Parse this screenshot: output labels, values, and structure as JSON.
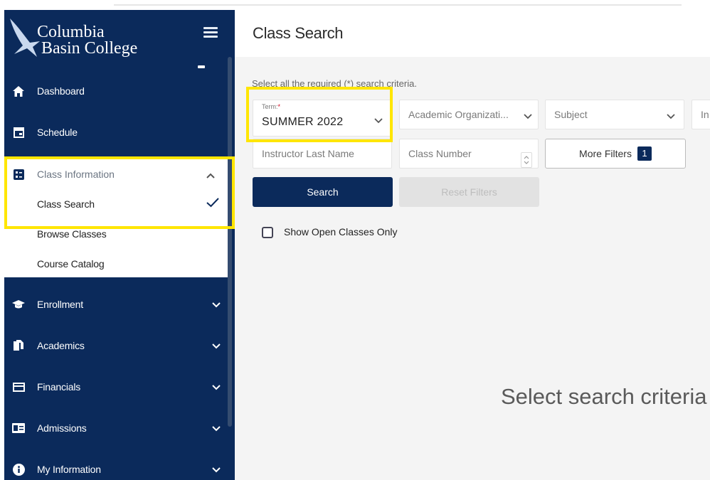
{
  "brand": {
    "line1": "Columbia",
    "line2": "Basin College"
  },
  "sidebar": {
    "items": [
      {
        "label": "Dashboard",
        "icon": "home-icon"
      },
      {
        "label": "Schedule",
        "icon": "calendar-icon"
      },
      {
        "label": "Enrollment",
        "icon": "graduation-cap-icon"
      },
      {
        "label": "Academics",
        "icon": "document-icon"
      },
      {
        "label": "Financials",
        "icon": "credit-card-icon"
      },
      {
        "label": "Admissions",
        "icon": "id-card-icon"
      },
      {
        "label": "My Information",
        "icon": "info-icon"
      }
    ],
    "class_information": {
      "label": "Class Information",
      "subitems": [
        "Class Search",
        "Browse Classes",
        "Course Catalog"
      ],
      "selected": "Class Search"
    }
  },
  "main": {
    "title": "Class Search",
    "instruction": "Select all the required (*) search criteria.",
    "term": {
      "label": "Term:",
      "required_marker": "*",
      "value": "SUMMER 2022"
    },
    "academic_org": {
      "placeholder": "Academic Organizati..."
    },
    "subject": {
      "placeholder": "Subject"
    },
    "cutoff_field": {
      "placeholder": "In"
    },
    "instructor": {
      "placeholder": "Instructor Last Name"
    },
    "class_number": {
      "placeholder": "Class Number"
    },
    "more_filters": {
      "label": "More Filters",
      "count": "1"
    },
    "search_button": "Search",
    "reset_button": "Reset Filters",
    "open_only": {
      "label": "Show Open Classes Only",
      "checked": false
    },
    "empty_message": "Select search criteria"
  },
  "colors": {
    "navy": "#0b2a5b",
    "highlight": "#ffe600",
    "disabled": "#e2e2e2"
  }
}
